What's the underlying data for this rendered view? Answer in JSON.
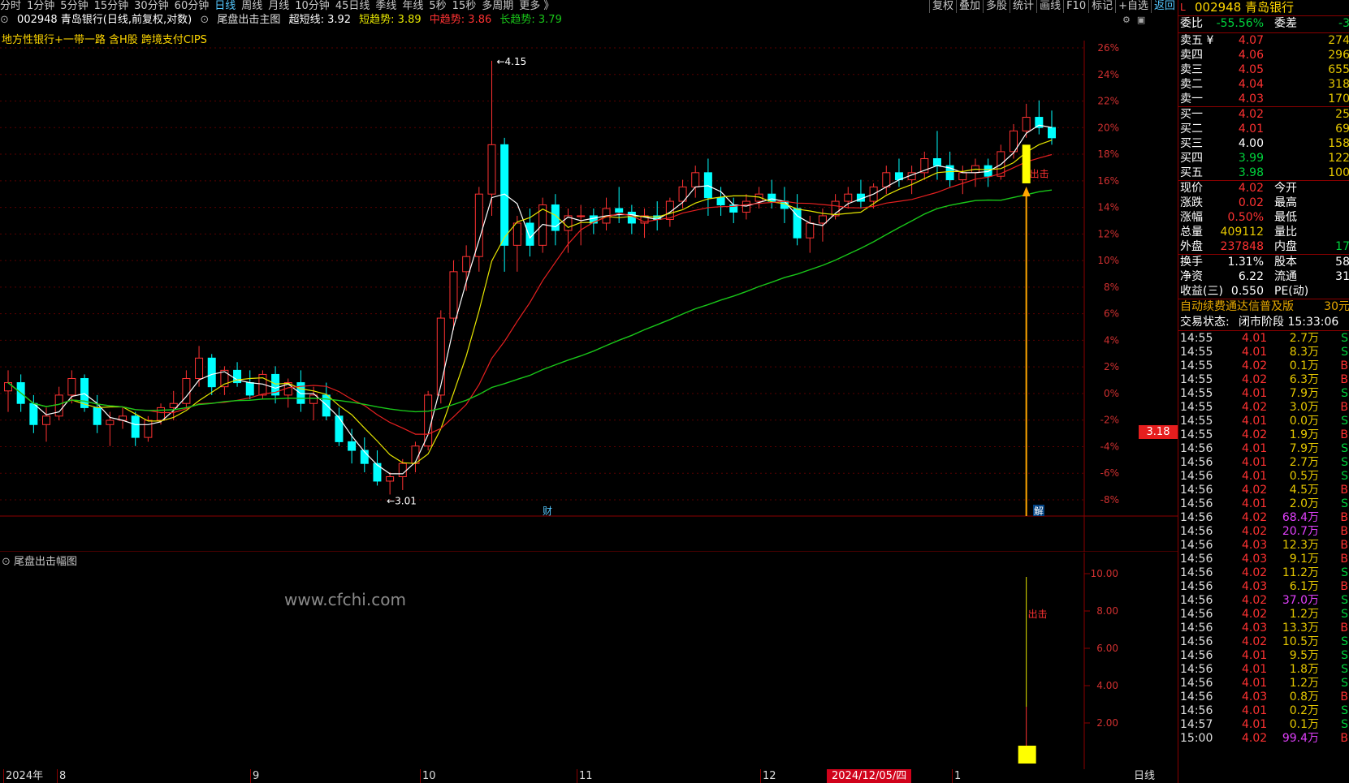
{
  "toolbar": {
    "periods": [
      "分时",
      "1分钟",
      "5分钟",
      "15分钟",
      "30分钟",
      "60分钟",
      "日线",
      "周线",
      "月线",
      "10分钟",
      "45日线",
      "季线",
      "年线",
      "5秒",
      "15秒",
      "多周期",
      "更多 》"
    ],
    "active_period": "日线",
    "right_tools": [
      "复权",
      "叠加",
      "多股",
      "统计",
      "画线",
      "F10",
      "标记",
      "+自选",
      "返回"
    ]
  },
  "indicator_header": {
    "stock": "002948 青岛银行(日线,前复权,对数)",
    "indicator": "尾盘出击主图",
    "super_short_label": "超短线: 3.92",
    "short_label": "短趋势: 3.89",
    "mid_label": "中趋势: 3.86",
    "long_label": "长趋势: 3.79"
  },
  "concepts": "地方性银行+一带一路 含H股 跨境支付CIPS",
  "chart_labels": {
    "high": "4.15",
    "low": "3.01",
    "signal": "出击",
    "cai_marker": "财",
    "jie_marker": "解",
    "price_tag": "3.18"
  },
  "colors": {
    "up": "#ff3232",
    "down": "#00ffff",
    "ma_white": "#ffffff",
    "ma_yellow": "#e6e600",
    "ma_red": "#e62020",
    "ma_green": "#19c619",
    "signal": "#ffff00",
    "arrow": "#ffa500"
  },
  "pct_axis": [
    "26%",
    "24%",
    "22%",
    "20%",
    "18%",
    "16%",
    "14%",
    "12%",
    "10%",
    "8%",
    "6%",
    "4%",
    "2%",
    "0%",
    "-2%",
    "-4%",
    "-6%",
    "-8%"
  ],
  "sub_chart": {
    "title": "尾盘出击幅图",
    "axis": [
      "10.00",
      "8.00",
      "6.00",
      "4.00",
      "2.00"
    ],
    "signal": "出击"
  },
  "watermark": "www.cfchi.com",
  "date_axis": {
    "labels": [
      "2024年",
      "8",
      "9",
      "10",
      "11",
      "12",
      "1"
    ],
    "selected_date": "2024/12/05/四",
    "period": "日线"
  },
  "quote_panel": {
    "title_code": "002948",
    "title_name": "青岛银行",
    "wei_bi_label": "委比",
    "wei_bi": "-55.56%",
    "wei_cha_label": "委差",
    "wei_cha": "-3",
    "sell": [
      {
        "label": "卖五 ¥",
        "price": "4.07",
        "vol": "274"
      },
      {
        "label": "卖四",
        "price": "4.06",
        "vol": "296"
      },
      {
        "label": "卖三",
        "price": "4.05",
        "vol": "655"
      },
      {
        "label": "卖二",
        "price": "4.04",
        "vol": "318"
      },
      {
        "label": "卖一",
        "price": "4.03",
        "vol": "170"
      }
    ],
    "buy": [
      {
        "label": "买一",
        "price": "4.02",
        "vol": "25"
      },
      {
        "label": "买二",
        "price": "4.01",
        "vol": "69"
      },
      {
        "label": "买三",
        "price": "4.00",
        "vol": "158"
      },
      {
        "label": "买四",
        "price": "3.99",
        "vol": "122"
      },
      {
        "label": "买五",
        "price": "3.98",
        "vol": "100"
      }
    ],
    "stats": [
      {
        "l1": "现价",
        "v1": "4.02",
        "l2": "今开",
        "v2": ""
      },
      {
        "l1": "涨跌",
        "v1": "0.02",
        "l2": "最高",
        "v2": ""
      },
      {
        "l1": "涨幅",
        "v1": "0.50%",
        "l2": "最低",
        "v2": ""
      },
      {
        "l1": "总量",
        "v1": "409112",
        "l2": "量比",
        "v2": ""
      },
      {
        "l1": "外盘",
        "v1": "237848",
        "l2": "内盘",
        "v2": "17"
      }
    ],
    "stats2": [
      {
        "l1": "换手",
        "v1": "1.31%",
        "l2": "股本",
        "v2": "58"
      },
      {
        "l1": "净资",
        "v1": "6.22",
        "l2": "流通",
        "v2": "31"
      },
      {
        "l1": "收益(三)",
        "v1": "0.550",
        "l2": "PE(动)",
        "v2": ""
      }
    ],
    "promo": "自动续费通达信普及版",
    "promo_price": "30元",
    "status_label": "交易状态:",
    "status_value": "闭市阶段 15:33:06",
    "ticks": [
      {
        "t": "14:55",
        "p": "4.01",
        "v": "2.7万",
        "bs": "S"
      },
      {
        "t": "14:55",
        "p": "4.01",
        "v": "8.3万",
        "bs": "S"
      },
      {
        "t": "14:55",
        "p": "4.02",
        "v": "0.1万",
        "bs": "B"
      },
      {
        "t": "14:55",
        "p": "4.02",
        "v": "6.3万",
        "bs": "B"
      },
      {
        "t": "14:55",
        "p": "4.01",
        "v": "7.9万",
        "bs": "S"
      },
      {
        "t": "14:55",
        "p": "4.02",
        "v": "3.0万",
        "bs": "B"
      },
      {
        "t": "14:55",
        "p": "4.01",
        "v": "0.0万",
        "bs": "S"
      },
      {
        "t": "14:55",
        "p": "4.02",
        "v": "1.9万",
        "bs": "B"
      },
      {
        "t": "14:56",
        "p": "4.01",
        "v": "7.9万",
        "bs": "S"
      },
      {
        "t": "14:56",
        "p": "4.01",
        "v": "2.7万",
        "bs": "S"
      },
      {
        "t": "14:56",
        "p": "4.01",
        "v": "0.5万",
        "bs": "S"
      },
      {
        "t": "14:56",
        "p": "4.02",
        "v": "4.5万",
        "bs": "B"
      },
      {
        "t": "14:56",
        "p": "4.01",
        "v": "2.0万",
        "bs": "S"
      },
      {
        "t": "14:56",
        "p": "4.02",
        "v": "68.4万",
        "bs": "B"
      },
      {
        "t": "14:56",
        "p": "4.02",
        "v": "20.7万",
        "bs": "B"
      },
      {
        "t": "14:56",
        "p": "4.03",
        "v": "12.3万",
        "bs": "B"
      },
      {
        "t": "14:56",
        "p": "4.03",
        "v": "9.1万",
        "bs": "B"
      },
      {
        "t": "14:56",
        "p": "4.02",
        "v": "11.2万",
        "bs": "S"
      },
      {
        "t": "14:56",
        "p": "4.03",
        "v": "6.1万",
        "bs": "B"
      },
      {
        "t": "14:56",
        "p": "4.02",
        "v": "37.0万",
        "bs": "S"
      },
      {
        "t": "14:56",
        "p": "4.02",
        "v": "1.2万",
        "bs": "S"
      },
      {
        "t": "14:56",
        "p": "4.03",
        "v": "13.3万",
        "bs": "B"
      },
      {
        "t": "14:56",
        "p": "4.02",
        "v": "10.5万",
        "bs": "S"
      },
      {
        "t": "14:56",
        "p": "4.01",
        "v": "9.5万",
        "bs": "S"
      },
      {
        "t": "14:56",
        "p": "4.01",
        "v": "1.8万",
        "bs": "S"
      },
      {
        "t": "14:56",
        "p": "4.01",
        "v": "1.2万",
        "bs": "S"
      },
      {
        "t": "14:56",
        "p": "4.03",
        "v": "0.8万",
        "bs": "B"
      },
      {
        "t": "14:56",
        "p": "4.01",
        "v": "0.2万",
        "bs": "S"
      },
      {
        "t": "14:57",
        "p": "4.01",
        "v": "0.1万",
        "bs": "S"
      },
      {
        "t": "15:00",
        "p": "4.02",
        "v": "99.4万",
        "bs": "B"
      }
    ]
  },
  "chart_data": {
    "type": "candlestick",
    "title": "002948 青岛银行(日线,前复权,对数)",
    "y_unit": "price (CNY), log scale; right axis in % from reference",
    "ylim": [
      3.0,
      4.2
    ],
    "annotations": {
      "high": 4.15,
      "low": 3.01
    },
    "candles": [
      [
        3.25,
        3.3,
        3.2,
        3.27
      ],
      [
        3.27,
        3.29,
        3.2,
        3.22
      ],
      [
        3.22,
        3.24,
        3.15,
        3.17
      ],
      [
        3.17,
        3.21,
        3.13,
        3.19
      ],
      [
        3.19,
        3.26,
        3.18,
        3.24
      ],
      [
        3.24,
        3.3,
        3.22,
        3.28
      ],
      [
        3.28,
        3.29,
        3.2,
        3.21
      ],
      [
        3.21,
        3.24,
        3.15,
        3.17
      ],
      [
        3.17,
        3.2,
        3.12,
        3.18
      ],
      [
        3.18,
        3.21,
        3.16,
        3.19
      ],
      [
        3.19,
        3.2,
        3.12,
        3.14
      ],
      [
        3.14,
        3.19,
        3.13,
        3.18
      ],
      [
        3.18,
        3.22,
        3.17,
        3.21
      ],
      [
        3.21,
        3.25,
        3.18,
        3.22
      ],
      [
        3.22,
        3.3,
        3.21,
        3.28
      ],
      [
        3.28,
        3.36,
        3.26,
        3.33
      ],
      [
        3.33,
        3.34,
        3.24,
        3.26
      ],
      [
        3.26,
        3.31,
        3.24,
        3.3
      ],
      [
        3.3,
        3.32,
        3.26,
        3.27
      ],
      [
        3.27,
        3.3,
        3.23,
        3.24
      ],
      [
        3.24,
        3.3,
        3.23,
        3.29
      ],
      [
        3.29,
        3.31,
        3.22,
        3.24
      ],
      [
        3.24,
        3.28,
        3.21,
        3.27
      ],
      [
        3.27,
        3.3,
        3.2,
        3.22
      ],
      [
        3.22,
        3.26,
        3.18,
        3.24
      ],
      [
        3.24,
        3.27,
        3.18,
        3.19
      ],
      [
        3.19,
        3.21,
        3.12,
        3.13
      ],
      [
        3.13,
        3.16,
        3.08,
        3.11
      ],
      [
        3.11,
        3.14,
        3.06,
        3.08
      ],
      [
        3.08,
        3.11,
        3.03,
        3.04
      ],
      [
        3.04,
        3.06,
        3.01,
        3.05
      ],
      [
        3.05,
        3.09,
        3.02,
        3.08
      ],
      [
        3.08,
        3.13,
        3.06,
        3.12
      ],
      [
        3.12,
        3.25,
        3.11,
        3.24
      ],
      [
        3.24,
        3.45,
        3.22,
        3.43
      ],
      [
        3.43,
        3.58,
        3.4,
        3.55
      ],
      [
        3.55,
        3.62,
        3.5,
        3.59
      ],
      [
        3.59,
        3.78,
        3.55,
        3.76
      ],
      [
        3.76,
        4.15,
        3.7,
        3.9
      ],
      [
        3.9,
        3.92,
        3.55,
        3.62
      ],
      [
        3.62,
        3.7,
        3.55,
        3.68
      ],
      [
        3.68,
        3.72,
        3.59,
        3.62
      ],
      [
        3.62,
        3.75,
        3.6,
        3.73
      ],
      [
        3.73,
        3.76,
        3.62,
        3.66
      ],
      [
        3.66,
        3.72,
        3.6,
        3.7
      ],
      [
        3.7,
        3.73,
        3.62,
        3.7
      ],
      [
        3.7,
        3.72,
        3.65,
        3.68
      ],
      [
        3.68,
        3.75,
        3.66,
        3.72
      ],
      [
        3.72,
        3.78,
        3.68,
        3.71
      ],
      [
        3.71,
        3.73,
        3.65,
        3.68
      ],
      [
        3.68,
        3.72,
        3.64,
        3.7
      ],
      [
        3.7,
        3.74,
        3.66,
        3.69
      ],
      [
        3.69,
        3.75,
        3.67,
        3.74
      ],
      [
        3.74,
        3.8,
        3.72,
        3.78
      ],
      [
        3.78,
        3.84,
        3.75,
        3.82
      ],
      [
        3.82,
        3.86,
        3.7,
        3.75
      ],
      [
        3.75,
        3.78,
        3.7,
        3.73
      ],
      [
        3.73,
        3.75,
        3.68,
        3.71
      ],
      [
        3.71,
        3.76,
        3.69,
        3.74
      ],
      [
        3.74,
        3.78,
        3.72,
        3.76
      ],
      [
        3.76,
        3.8,
        3.72,
        3.74
      ],
      [
        3.74,
        3.78,
        3.68,
        3.72
      ],
      [
        3.72,
        3.76,
        3.62,
        3.64
      ],
      [
        3.64,
        3.7,
        3.6,
        3.68
      ],
      [
        3.68,
        3.72,
        3.63,
        3.7
      ],
      [
        3.7,
        3.76,
        3.69,
        3.74
      ],
      [
        3.74,
        3.78,
        3.72,
        3.76
      ],
      [
        3.76,
        3.8,
        3.72,
        3.74
      ],
      [
        3.74,
        3.79,
        3.72,
        3.78
      ],
      [
        3.78,
        3.84,
        3.76,
        3.82
      ],
      [
        3.82,
        3.86,
        3.78,
        3.8
      ],
      [
        3.8,
        3.84,
        3.76,
        3.82
      ],
      [
        3.82,
        3.88,
        3.8,
        3.86
      ],
      [
        3.86,
        3.94,
        3.8,
        3.84
      ],
      [
        3.84,
        3.88,
        3.78,
        3.8
      ],
      [
        3.8,
        3.84,
        3.76,
        3.82
      ],
      [
        3.82,
        3.86,
        3.78,
        3.84
      ],
      [
        3.84,
        3.86,
        3.78,
        3.81
      ],
      [
        3.81,
        3.9,
        3.8,
        3.88
      ],
      [
        3.88,
        3.96,
        3.86,
        3.94
      ],
      [
        3.94,
        4.02,
        3.92,
        3.98
      ],
      [
        3.98,
        4.03,
        3.93,
        3.95
      ],
      [
        3.95,
        4.0,
        3.9,
        3.92
      ]
    ],
    "bands": [
      "超短线",
      "短趋势",
      "中趋势",
      "长趋势"
    ],
    "sub_indicator": {
      "name": "尾盘出击幅图",
      "signal_value": 10.0
    }
  }
}
